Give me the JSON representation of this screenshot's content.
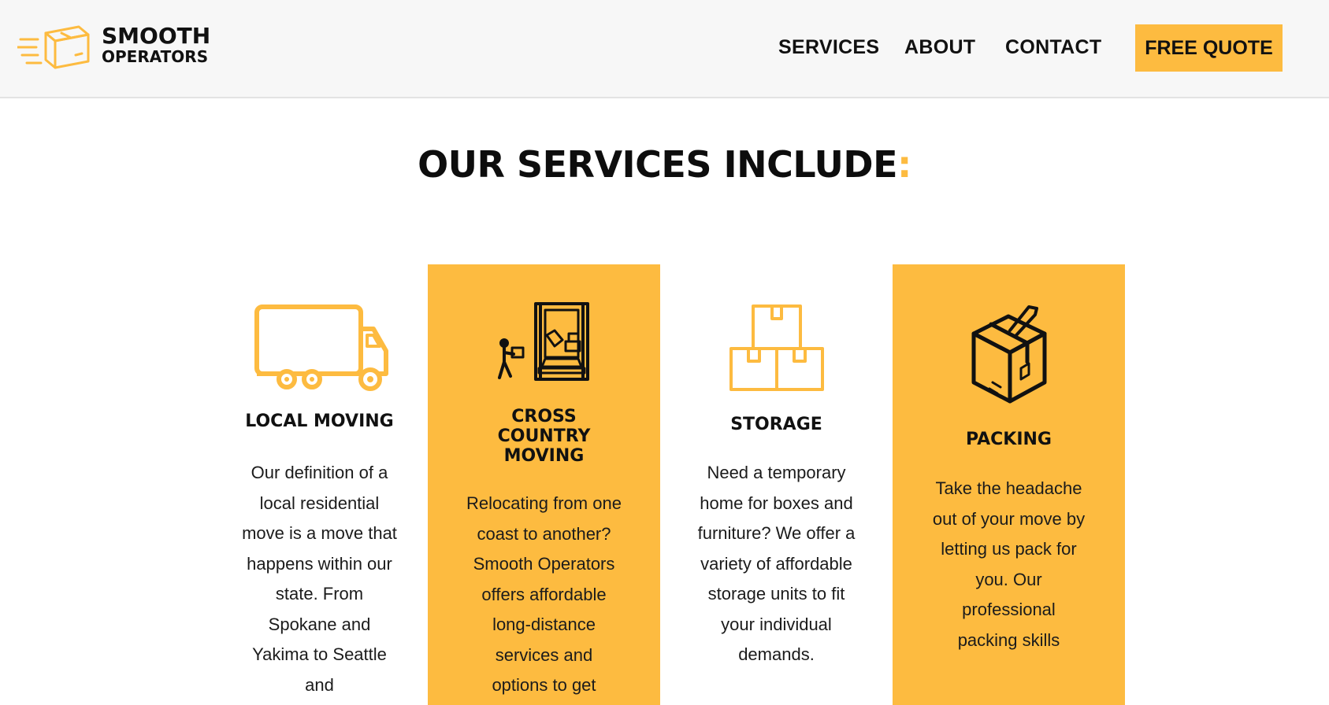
{
  "brand": {
    "line1": "SMOOTH",
    "line2": "OPERATORS"
  },
  "nav": {
    "services": "SERVICES",
    "about": "ABOUT",
    "contact": "CONTACT",
    "cta": "FREE QUOTE"
  },
  "section": {
    "title": "OUR SERVICES INCLUDE",
    "title_accent": ":"
  },
  "colors": {
    "accent": "#fdbb40",
    "header_bg": "#f7f7f7",
    "text": "#111111"
  },
  "services": [
    {
      "icon": "moving-truck-icon",
      "title": "LOCAL MOVING",
      "text": "Our definition of a local residential move is a move that happens within our state. From Spokane and Yakima to Seattle and"
    },
    {
      "icon": "loading-truck-icon",
      "title": "CROSS COUNTRY MOVING",
      "text": "Relocating from one coast to another? Smooth Operators offers affordable long-distance services and options to get"
    },
    {
      "icon": "storage-boxes-icon",
      "title": "STORAGE",
      "text": "Need a temporary home for boxes and furniture? We offer a variety of affordable storage units to fit your individual demands."
    },
    {
      "icon": "packing-box-icon",
      "title": "PACKING",
      "text": "Take the headache out of your move by letting us pack for you. Our professional packing skills"
    }
  ]
}
